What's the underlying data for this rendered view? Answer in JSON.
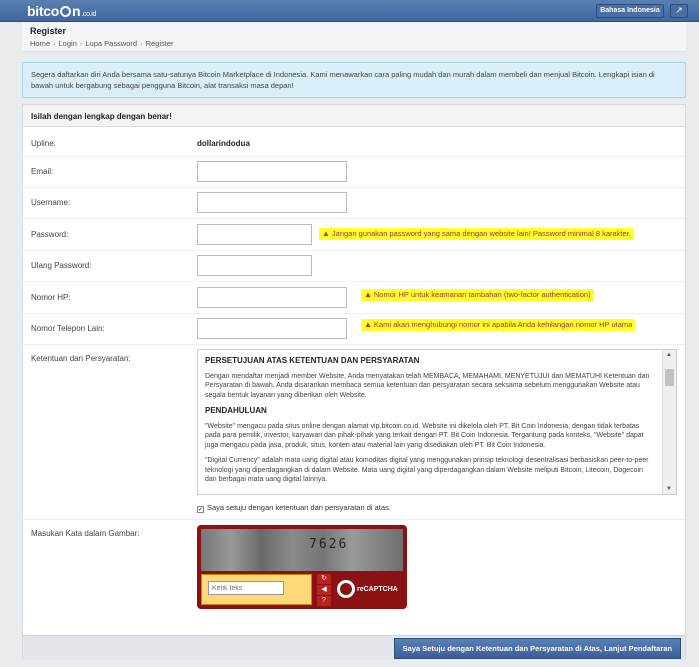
{
  "topbar": {
    "logo_text": "bitco",
    "logo_text2": "n",
    "logo_tld": ".co.id",
    "language_button": "Bahasa Indonesia",
    "logout_icon": "logout-icon"
  },
  "header": {
    "title": "Register",
    "breadcrumb": [
      "Home",
      "Login",
      "Lupa Password",
      "Register"
    ]
  },
  "info_text": "Segera daftarkan diri Anda bersama satu-satunya Bitcoin Marketplace di Indonesia. Kami menawarkan cara paling mudah dan murah dalam membeli dan menjual Bitcoin. Lengkapi isian di bawah untuk bergabung sebagai pengguna Bitcoin, alat transaksi masa depan!",
  "form": {
    "heading": "Isilah dengan lengkap dengan benar!",
    "upline_label": "Upline:",
    "upline_value": "dollarindodua",
    "email_label": "Email:",
    "username_label": "Username:",
    "password_label": "Password:",
    "password_warning": "Jangan gunakan password yang sama dengan website lain! Password minimal 8 karakter.",
    "repeat_password_label": "Ulang Password:",
    "phone_label": "Nomor HP:",
    "phone_warning": "Nomor HP untuk keamanan tambahan (two-factor authentication)",
    "other_phone_label": "Nomor Telepon Lain:",
    "other_phone_warning": "Kami akan menghubungi nomor ini apabila Anda kehilangan nomor HP utama",
    "terms_label": "Ketentuan dan Persyaratan:",
    "terms": {
      "heading1": "PERSETUJUAN ATAS KETENTUAN DAN PERSYARATAN",
      "para1": "Dengan mendaftar menjadi member Website, Anda menyatakan telah MEMBACA, MEMAHAMI, MENYETUJUI dan MEMATUHI Ketentuan dan Persyaratan di bawah. Anda disarankan membaca semua ketentuan dan persyaratan secara seksama sebelum menggunakan Website atau segala bentuk layanan yang diberikan oleh Website.",
      "heading2": "PENDAHULUAN",
      "para2": "\"Website\" mengacu pada situs online dengan alamat vip.bitcoin.co.id. Website ini dikelola oleh PT. Bit Coin Indonesia, dengan tidak terbatas pada para pemilik, investor, karyawan dan pihak-pihak yang terkait dengan PT. Bit Coin Indonesia. Tergantung pada konteks, \"Website\" dapat juga mengacu pada jasa, produk, situs, konten atau material lain yang disediakan oleh PT. Bit Coin Indonesia.",
      "para3": "\"Digital Currency\" adalah mata uang digital atau komoditas digital yang menggunakan prinsip teknologi desentralisasi berbasiskan peer-to-peer teknologi yang diperdagangkan di dalam Website. Mata uang digital yang diperdagangkan dalam Website meliputi Bitcoin, Litecoin, Dogecoin dan berbagai mata uang digital lainnya."
    },
    "agree_text": "Saya setuju dengan ketentuan dan persyaratan di atas.",
    "captcha_label": "Masukan Kata dalam Gambar:",
    "captcha_word": "7626",
    "captcha_placeholder": "Ketik teks",
    "captcha_brand": "reCAPTCHA",
    "submit_label": "Saya Setuju dengan Ketentuan dan Persyaratan di Atas, Lanjut Pendaftaran"
  },
  "colors": {
    "topbar": "#4a70a6",
    "warning_bg": "#ffff2a",
    "info_bg": "#d9eef9",
    "captcha_red": "#8a1212"
  }
}
